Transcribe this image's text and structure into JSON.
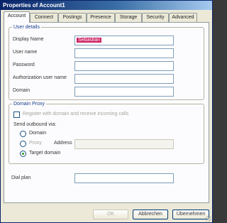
{
  "window": {
    "title": "Properties of Account1"
  },
  "tabs": [
    {
      "label": "Account"
    },
    {
      "label": "Connect"
    },
    {
      "label": "Postings"
    },
    {
      "label": "Presence"
    },
    {
      "label": "Storage"
    },
    {
      "label": "Security"
    },
    {
      "label": "Advanced"
    }
  ],
  "user_details": {
    "legend": "User details",
    "display_name_label": "Display Name",
    "display_name_value": "Sebastian",
    "username_label": "User name",
    "password_label": "Password",
    "auth_username_label": "Authorization user name",
    "domain_label": "Domain"
  },
  "domain_proxy": {
    "legend": "Domain Proxy",
    "checkbox_label": "Register with domain and receive incoming calls",
    "send_outbound_label": "Send outbound via:",
    "option_domain": "Domain",
    "option_proxy": "Proxy",
    "address_label": "Address",
    "option_target": "Target domain"
  },
  "dial_plan": {
    "label": "Dial plan"
  },
  "buttons": {
    "ok": "OK",
    "cancel": "Abbrechen",
    "apply": "Übernehmen"
  }
}
